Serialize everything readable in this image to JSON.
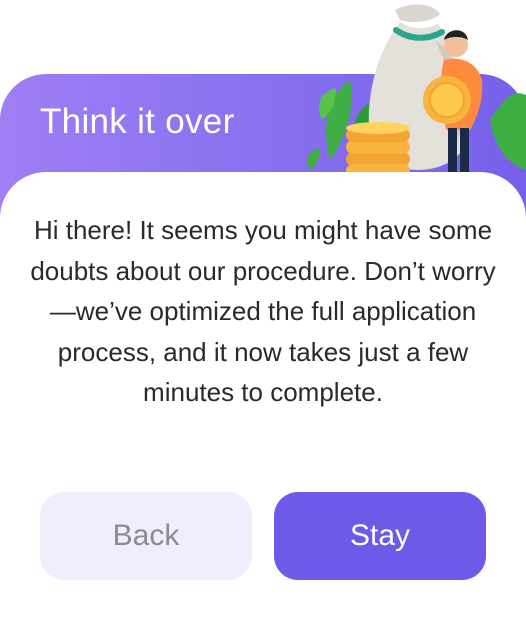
{
  "dialog": {
    "title": "Think it over",
    "message": "Hi there! It seems you might have some doubts about our procedure. Don’t worry—we’ve optimized the full application process, and it now takes just a few minutes to complete.",
    "buttons": {
      "back_label": "Back",
      "stay_label": "Stay"
    }
  },
  "illustration": {
    "icon": "money-bag-and-coins-illustration"
  },
  "colors": {
    "header_gradient_start": "#a07ef6",
    "header_gradient_end": "#7660ea",
    "primary_button": "#6e5ae8",
    "secondary_button": "#efeefc",
    "text": "#2a2a2a"
  }
}
